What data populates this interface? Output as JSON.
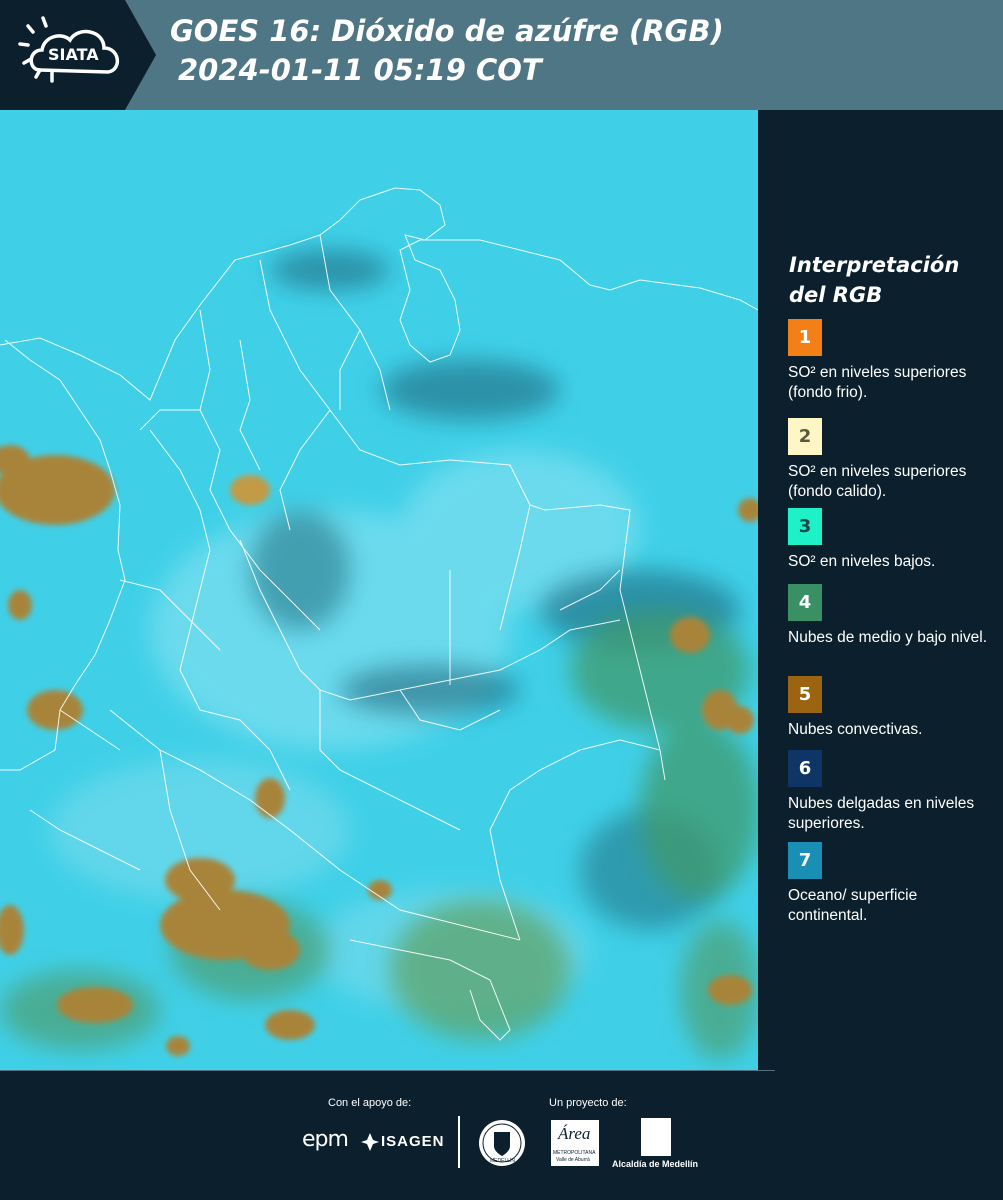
{
  "header": {
    "logo_text": "SIATA",
    "title_line1": "GOES 16: Dióxido de azúfre (RGB)",
    "title_line2": "2024-01-11 05:19 COT"
  },
  "colors": {
    "header_bg": "#4f7684",
    "logo_bg": "#0b1f2c",
    "page_bg": "#0b1f2c",
    "map_base": "#3fd0e8",
    "convective": "#a8843a",
    "low_mid_clouds": "#3f9a6c",
    "thin_high_clouds": "#1d5f73"
  },
  "legend": {
    "title": "Interpretación del RGB",
    "items": [
      {
        "number": "1",
        "color": "#f57f17",
        "number_color": "#ffffff",
        "label": "SO² en niveles superiores (fondo frio)."
      },
      {
        "number": "2",
        "color": "#fff6c6",
        "number_color": "#5a5a3a",
        "label": "SO² en niveles superiores (fondo calido)."
      },
      {
        "number": "3",
        "color": "#1ef0c8",
        "number_color": "#1c4a48",
        "label": "SO² en niveles bajos."
      },
      {
        "number": "4",
        "color": "#3a8f63",
        "number_color": "#ffffff",
        "label": "Nubes de medio y bajo nivel."
      },
      {
        "number": "5",
        "color": "#9c6410",
        "number_color": "#ffffff",
        "label": "Nubes convectivas."
      },
      {
        "number": "6",
        "color": "#0e3566",
        "number_color": "#ffffff",
        "label": "Nubes delgadas en niveles superiores."
      },
      {
        "number": "7",
        "color": "#1a8fb5",
        "number_color": "#ffffff",
        "label": "Oceano/ superficie continental."
      }
    ]
  },
  "footer": {
    "support_label": "Con el apoyo de:",
    "project_label": "Un proyecto de:",
    "sponsor_epm": "epm",
    "sponsor_isagen": "ISAGEN",
    "partner_medellin_seal": "MEDELLÍN",
    "partner_area": "Área",
    "partner_area_sub1": "METROPOLITANA",
    "partner_area_sub2": "Valle de Aburrá",
    "partner_alcaldia": "Alcaldía de Medellín"
  }
}
